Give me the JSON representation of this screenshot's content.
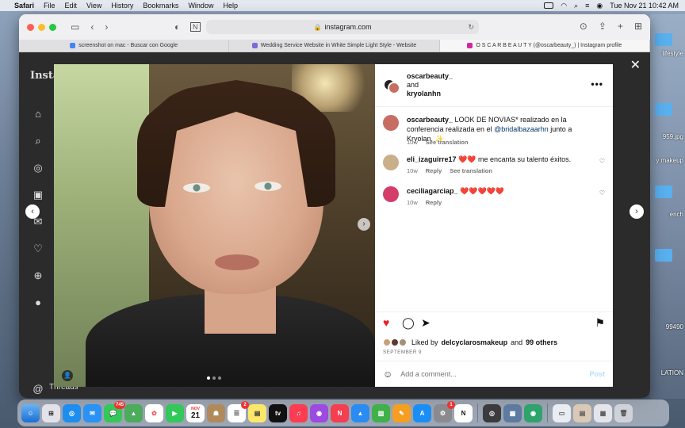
{
  "menubar": {
    "app_name": "Safari",
    "items": [
      "File",
      "Edit",
      "View",
      "History",
      "Bookmarks",
      "Window",
      "Help"
    ],
    "datetime": "Tue Nov 21  10:42 AM"
  },
  "browser": {
    "url": "instagram.com",
    "tabs": [
      {
        "title": "screenshot on mac - Buscar con Google",
        "favicon_color": "#4285f4"
      },
      {
        "title": "Wedding Service Website in White Simple Light Style - Website",
        "favicon_color": "#7c6ad6"
      },
      {
        "title": "O S C A R B E A U T Y (@oscarbeauty_) | Instagram profile",
        "favicon_color": "#d6249f"
      }
    ]
  },
  "instagram": {
    "logo": "Insta",
    "threads_label": "Threads",
    "threads_badge": "9+",
    "post": {
      "authors": [
        "oscarbeauty_",
        "and",
        "kryolanhn"
      ],
      "caption": {
        "user": "oscarbeauty_",
        "text_before": "LOOK DE NOVIAS* realizado en la conferencia realizada en el",
        "mention": "@bridalbazaarhn",
        "text_after": "junto a Kryolan. ✨",
        "age": "10w",
        "see_translation": "See translation"
      },
      "comments": [
        {
          "user": "eli_izaguirre17",
          "text": "me encanta su talento éxitos.",
          "hearts": "❤️❤️",
          "age": "10w",
          "reply": "Reply",
          "see_translation": "See translation"
        },
        {
          "user": "ceciliagarciap_",
          "text": "",
          "hearts": "❤️❤️❤️❤️❤️",
          "age": "10w",
          "reply": "Reply"
        }
      ],
      "liked_by_prefix": "Liked by",
      "liked_by_user": "delcyclarosmakeup",
      "liked_by_conj": "and",
      "liked_by_others": "99 others",
      "date": "SEPTEMBER 9",
      "add_comment_placeholder": "Add a comment...",
      "post_button": "Post"
    }
  },
  "desktop_labels": [
    "lifestyle",
    "959.jpg",
    "y makeup",
    "ench",
    "99490",
    "LATION"
  ],
  "dock": {
    "calendar_month": "NOV",
    "calendar_day": "21",
    "messages_badge": "745",
    "reminders_badge": "2",
    "mail_badge": "1"
  }
}
